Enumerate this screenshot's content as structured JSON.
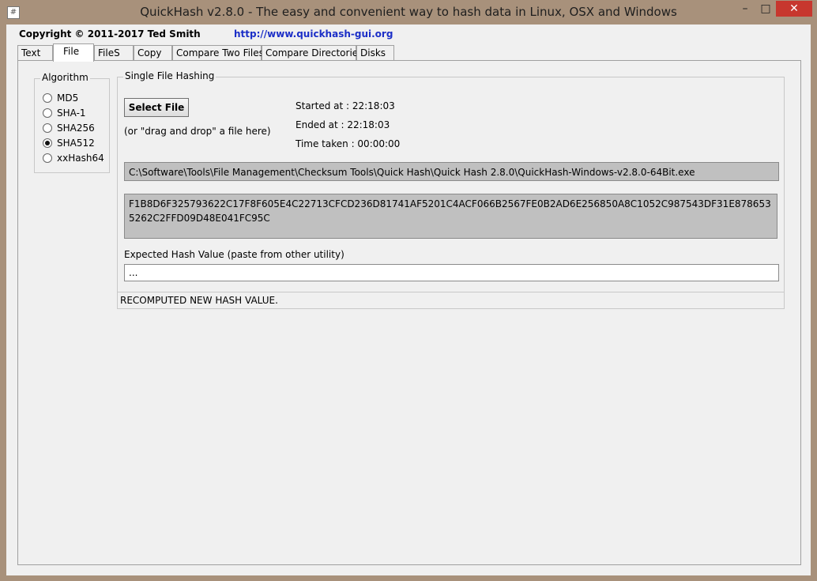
{
  "window": {
    "title": "QuickHash v2.8.0 - The easy and convenient way to hash data in Linux, OSX and Windows",
    "icon_glyph": "#",
    "controls": {
      "minimize": "–",
      "maximize": "□",
      "close": "✕"
    }
  },
  "header": {
    "copyright": "Copyright © 2011-2017  Ted Smith",
    "url": "http://www.quickhash-gui.org"
  },
  "tabs": [
    {
      "label": "Text"
    },
    {
      "label": "File"
    },
    {
      "label": "FileS"
    },
    {
      "label": "Copy"
    },
    {
      "label": "Compare Two Files"
    },
    {
      "label": "Compare Directories"
    },
    {
      "label": "Disks"
    }
  ],
  "active_tab": "File",
  "algorithm": {
    "title": "Algorithm",
    "options": [
      {
        "label": "MD5"
      },
      {
        "label": "SHA-1"
      },
      {
        "label": "SHA256"
      },
      {
        "label": "SHA512"
      },
      {
        "label": "xxHash64"
      }
    ],
    "selected": "SHA512"
  },
  "single": {
    "title": "Single File Hashing",
    "select_button": "Select File",
    "hint": "(or \"drag and drop\" a file here)",
    "started": "Started at : 22:18:03",
    "ended": "Ended at : 22:18:03",
    "taken": "Time taken : 00:00:00",
    "file_path": "C:\\Software\\Tools\\File Management\\Checksum Tools\\Quick Hash\\Quick Hash 2.8.0\\QuickHash-Windows-v2.8.0-64Bit.exe",
    "hash_value": "F1B8D6F325793622C17F8F605E4C22713CFCD236D81741AF5201C4ACF066B2567FE0B2AD6E256850A8C1052C987543DF31E8786535262C2FFD09D48E041FC95C",
    "expected_label": "Expected Hash Value (paste from other utility)",
    "expected_value": "...",
    "status": "RECOMPUTED NEW HASH VALUE."
  },
  "colors": {
    "window_frame": "#a8917b",
    "close_button": "#c7372e",
    "url_link": "#1c2fc7",
    "field_gray": "#c0c0c0"
  }
}
